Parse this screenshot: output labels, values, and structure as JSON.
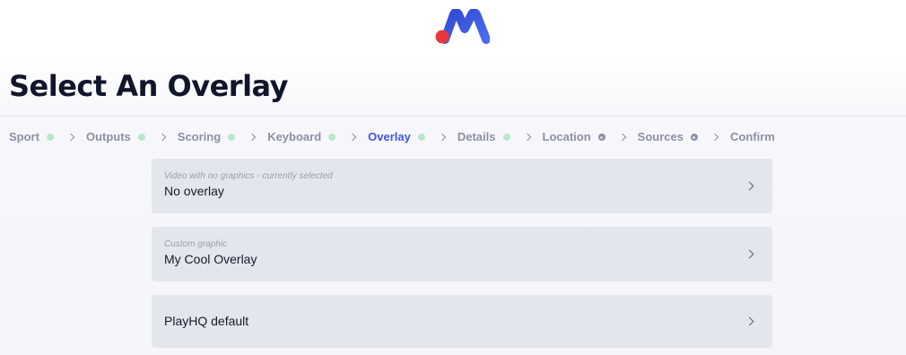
{
  "header": {
    "logo_icon": "m-brand-logo-icon",
    "title": "Select An Overlay"
  },
  "stepper": {
    "steps": [
      {
        "label": "Sport",
        "status": "done"
      },
      {
        "label": "Outputs",
        "status": "done"
      },
      {
        "label": "Scoring",
        "status": "done"
      },
      {
        "label": "Keyboard",
        "status": "done"
      },
      {
        "label": "Overlay",
        "status": "active"
      },
      {
        "label": "Details",
        "status": "done"
      },
      {
        "label": "Location",
        "status": "pending"
      },
      {
        "label": "Sources",
        "status": "pending"
      },
      {
        "label": "Confirm",
        "status": "none"
      }
    ],
    "separator_icon": "chevron-right-icon"
  },
  "options": [
    {
      "subtitle": "Video with no graphics - currently selected",
      "title": "No overlay"
    },
    {
      "subtitle": "Custom graphic",
      "title": "My Cool Overlay"
    },
    {
      "subtitle": "",
      "title": "PlayHQ default"
    }
  ],
  "colors": {
    "active_step": "#4154e8",
    "done_dot": "#b9e9c8",
    "pending_dot": "#8a90a6",
    "option_bg": "#e3e6ec",
    "logo_red": "#e8383d",
    "logo_blue": "#3b5bdb"
  }
}
